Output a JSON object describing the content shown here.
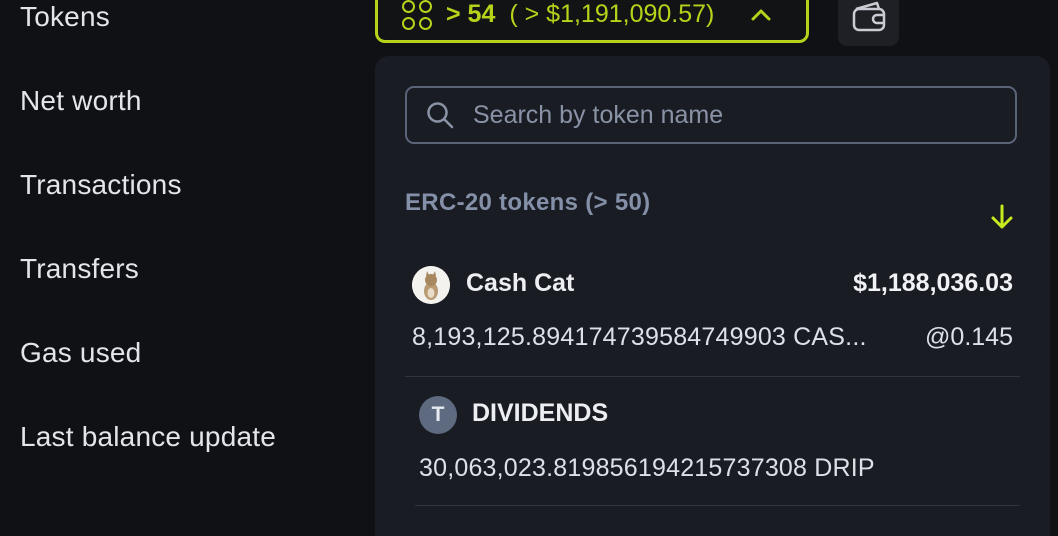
{
  "sidebar": {
    "items": [
      "Tokens",
      "Net worth",
      "Transactions",
      "Transfers",
      "Gas used",
      "Last balance update"
    ]
  },
  "tokens_button": {
    "count": "> 54",
    "value": "( > $1,191,090.57)"
  },
  "search": {
    "placeholder": "Search by token name"
  },
  "section": {
    "title": "ERC-20 tokens (> 50)"
  },
  "tokens": [
    {
      "name": "Cash Cat",
      "value": "$1,188,036.03",
      "amount": "8,193,125.894174739584749903 CAS...",
      "price": "@0.145",
      "avatar": "cat-avatar"
    },
    {
      "name": "DIVIDENDS",
      "value": "",
      "amount": "30,063,023.819856194215737308 DRIP",
      "price": "",
      "avatar": "T"
    }
  ],
  "colors": {
    "accent": "#b7d21a",
    "background": "#101114",
    "panel": "#1a1c24"
  }
}
